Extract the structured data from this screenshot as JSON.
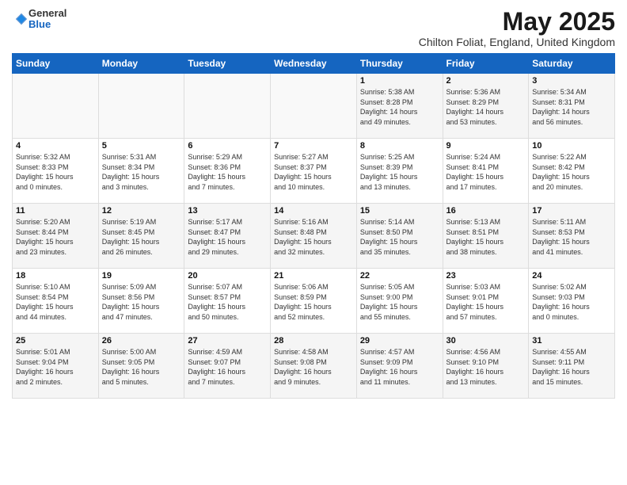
{
  "header": {
    "logo_general": "General",
    "logo_blue": "Blue",
    "month_title": "May 2025",
    "location": "Chilton Foliat, England, United Kingdom"
  },
  "weekdays": [
    "Sunday",
    "Monday",
    "Tuesday",
    "Wednesday",
    "Thursday",
    "Friday",
    "Saturday"
  ],
  "weeks": [
    [
      {
        "day": "",
        "info": ""
      },
      {
        "day": "",
        "info": ""
      },
      {
        "day": "",
        "info": ""
      },
      {
        "day": "",
        "info": ""
      },
      {
        "day": "1",
        "info": "Sunrise: 5:38 AM\nSunset: 8:28 PM\nDaylight: 14 hours\nand 49 minutes."
      },
      {
        "day": "2",
        "info": "Sunrise: 5:36 AM\nSunset: 8:29 PM\nDaylight: 14 hours\nand 53 minutes."
      },
      {
        "day": "3",
        "info": "Sunrise: 5:34 AM\nSunset: 8:31 PM\nDaylight: 14 hours\nand 56 minutes."
      }
    ],
    [
      {
        "day": "4",
        "info": "Sunrise: 5:32 AM\nSunset: 8:33 PM\nDaylight: 15 hours\nand 0 minutes."
      },
      {
        "day": "5",
        "info": "Sunrise: 5:31 AM\nSunset: 8:34 PM\nDaylight: 15 hours\nand 3 minutes."
      },
      {
        "day": "6",
        "info": "Sunrise: 5:29 AM\nSunset: 8:36 PM\nDaylight: 15 hours\nand 7 minutes."
      },
      {
        "day": "7",
        "info": "Sunrise: 5:27 AM\nSunset: 8:37 PM\nDaylight: 15 hours\nand 10 minutes."
      },
      {
        "day": "8",
        "info": "Sunrise: 5:25 AM\nSunset: 8:39 PM\nDaylight: 15 hours\nand 13 minutes."
      },
      {
        "day": "9",
        "info": "Sunrise: 5:24 AM\nSunset: 8:41 PM\nDaylight: 15 hours\nand 17 minutes."
      },
      {
        "day": "10",
        "info": "Sunrise: 5:22 AM\nSunset: 8:42 PM\nDaylight: 15 hours\nand 20 minutes."
      }
    ],
    [
      {
        "day": "11",
        "info": "Sunrise: 5:20 AM\nSunset: 8:44 PM\nDaylight: 15 hours\nand 23 minutes."
      },
      {
        "day": "12",
        "info": "Sunrise: 5:19 AM\nSunset: 8:45 PM\nDaylight: 15 hours\nand 26 minutes."
      },
      {
        "day": "13",
        "info": "Sunrise: 5:17 AM\nSunset: 8:47 PM\nDaylight: 15 hours\nand 29 minutes."
      },
      {
        "day": "14",
        "info": "Sunrise: 5:16 AM\nSunset: 8:48 PM\nDaylight: 15 hours\nand 32 minutes."
      },
      {
        "day": "15",
        "info": "Sunrise: 5:14 AM\nSunset: 8:50 PM\nDaylight: 15 hours\nand 35 minutes."
      },
      {
        "day": "16",
        "info": "Sunrise: 5:13 AM\nSunset: 8:51 PM\nDaylight: 15 hours\nand 38 minutes."
      },
      {
        "day": "17",
        "info": "Sunrise: 5:11 AM\nSunset: 8:53 PM\nDaylight: 15 hours\nand 41 minutes."
      }
    ],
    [
      {
        "day": "18",
        "info": "Sunrise: 5:10 AM\nSunset: 8:54 PM\nDaylight: 15 hours\nand 44 minutes."
      },
      {
        "day": "19",
        "info": "Sunrise: 5:09 AM\nSunset: 8:56 PM\nDaylight: 15 hours\nand 47 minutes."
      },
      {
        "day": "20",
        "info": "Sunrise: 5:07 AM\nSunset: 8:57 PM\nDaylight: 15 hours\nand 50 minutes."
      },
      {
        "day": "21",
        "info": "Sunrise: 5:06 AM\nSunset: 8:59 PM\nDaylight: 15 hours\nand 52 minutes."
      },
      {
        "day": "22",
        "info": "Sunrise: 5:05 AM\nSunset: 9:00 PM\nDaylight: 15 hours\nand 55 minutes."
      },
      {
        "day": "23",
        "info": "Sunrise: 5:03 AM\nSunset: 9:01 PM\nDaylight: 15 hours\nand 57 minutes."
      },
      {
        "day": "24",
        "info": "Sunrise: 5:02 AM\nSunset: 9:03 PM\nDaylight: 16 hours\nand 0 minutes."
      }
    ],
    [
      {
        "day": "25",
        "info": "Sunrise: 5:01 AM\nSunset: 9:04 PM\nDaylight: 16 hours\nand 2 minutes."
      },
      {
        "day": "26",
        "info": "Sunrise: 5:00 AM\nSunset: 9:05 PM\nDaylight: 16 hours\nand 5 minutes."
      },
      {
        "day": "27",
        "info": "Sunrise: 4:59 AM\nSunset: 9:07 PM\nDaylight: 16 hours\nand 7 minutes."
      },
      {
        "day": "28",
        "info": "Sunrise: 4:58 AM\nSunset: 9:08 PM\nDaylight: 16 hours\nand 9 minutes."
      },
      {
        "day": "29",
        "info": "Sunrise: 4:57 AM\nSunset: 9:09 PM\nDaylight: 16 hours\nand 11 minutes."
      },
      {
        "day": "30",
        "info": "Sunrise: 4:56 AM\nSunset: 9:10 PM\nDaylight: 16 hours\nand 13 minutes."
      },
      {
        "day": "31",
        "info": "Sunrise: 4:55 AM\nSunset: 9:11 PM\nDaylight: 16 hours\nand 15 minutes."
      }
    ]
  ]
}
